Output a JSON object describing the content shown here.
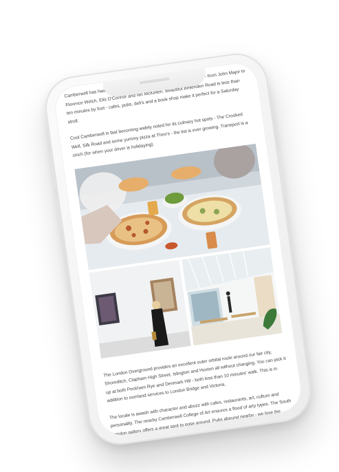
{
  "paragraphs": {
    "p1": "Camberwell has had more than its fair share of high profile inhabitants - from John Major to Florence Welch, Elis O'Connor and Ian McKellen. Beautiful Bellenden Road is less than ten minutes by foot - cafes, pubs, deli's and a book shop make it perfect for a Saturday stroll.",
    "p2": "Cool Camberwell is fast becoming widely noted for its culinary hot spots - The Crooked Well, Silk Road and some yummy pizza at Theo's - the list is ever growing. Transport is a cinch (for when your driver is holidaying).",
    "p3": "The London Overground provides an excellent outer orbital route around our fair city, Shoreditch, Clapham High Street, Islington and Hoxton all without changing. You can pick it up at both Peckham Rye and Denmark Hill - both less than 10 minutes' walk. This is in addition to overland services to London Bridge and Victoria.",
    "p4": "The locale is awash with character and abuzz with cafes, restaurants, art, culture and personality. The nearby Camberwell College of Art ensures a flood of arty types. The South London gallery offers a great spot to pose around. Pubs abound nearby - we love the Hermits cave, Sun of Camberwell, George Canning, Crooked Well and the Storm Bird."
  },
  "images": {
    "pizza": "pizza-table-photo",
    "gallery": "art-gallery-photo",
    "cafe": "gallery-cafe-photo"
  },
  "colors": {
    "body_text": "#444444",
    "phone_frame": "#f2f2f2",
    "screen": "#ffffff"
  }
}
